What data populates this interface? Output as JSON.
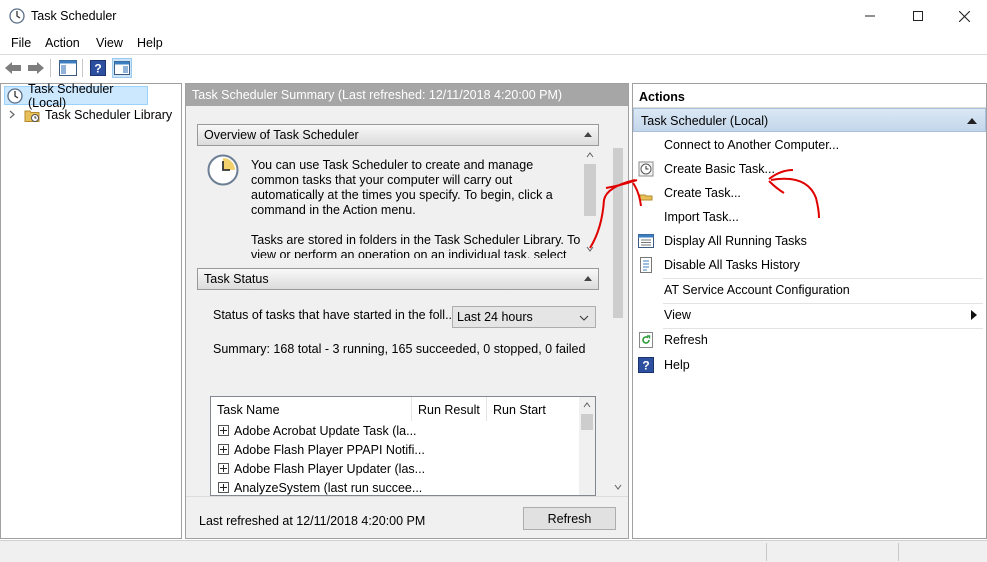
{
  "window": {
    "title": "Task Scheduler",
    "minimize_glyph": "—",
    "maximize_glyph": "☐",
    "close_glyph": "✕"
  },
  "menu": {
    "items": [
      "File",
      "Action",
      "View",
      "Help"
    ]
  },
  "tree": {
    "root": "Task Scheduler (Local)",
    "child": "Task Scheduler Library"
  },
  "middle": {
    "header": "Task Scheduler Summary (Last refreshed: 12/11/2018 4:20:00 PM)",
    "overview": {
      "title": "Overview of Task Scheduler",
      "text1": "You can use Task Scheduler to create and manage common tasks that your computer will carry out automatically at the times you specify. To begin, click a command in the Action menu.",
      "text2": "Tasks are stored in folders in the Task Scheduler Library. To view or perform an operation on an individual task, select"
    },
    "task_status": {
      "title": "Task Status",
      "label": "Status of tasks that have started in the foll...",
      "select_value": "Last 24 hours",
      "summary": "Summary: 168 total - 3 running, 165 succeeded, 0 stopped, 0 failed"
    },
    "table": {
      "columns": [
        "Task Name",
        "Run Result",
        "Run Start"
      ],
      "rows": [
        "Adobe Acrobat Update Task (la...",
        "Adobe Flash Player PPAPI Notifi...",
        "Adobe Flash Player Updater (las...",
        "AnalyzeSystem (last run succee..."
      ]
    },
    "footer": {
      "last_refreshed": "Last refreshed at 12/11/2018 4:20:00 PM",
      "refresh_label": "Refresh"
    }
  },
  "actions": {
    "title": "Actions",
    "group": "Task Scheduler (Local)",
    "items": [
      {
        "label": "Connect to Another Computer...",
        "icon": "none"
      },
      {
        "label": "Create Basic Task...",
        "icon": "clock-icon"
      },
      {
        "label": "Create Task...",
        "icon": "folder-icon"
      },
      {
        "label": "Import Task...",
        "icon": "none"
      },
      {
        "label": "Display All Running Tasks",
        "icon": "list-icon"
      },
      {
        "label": "Disable All Tasks History",
        "icon": "history-icon"
      },
      {
        "label": "AT Service Account Configuration",
        "icon": "none"
      },
      {
        "label": "View",
        "icon": "none"
      },
      {
        "label": "Refresh",
        "icon": "refresh-icon"
      },
      {
        "label": "Help",
        "icon": "help-icon"
      }
    ]
  },
  "colors": {
    "annotation": "#e00000",
    "group_header": "#c3d6ea",
    "tree_selected": "#cce8ff"
  }
}
